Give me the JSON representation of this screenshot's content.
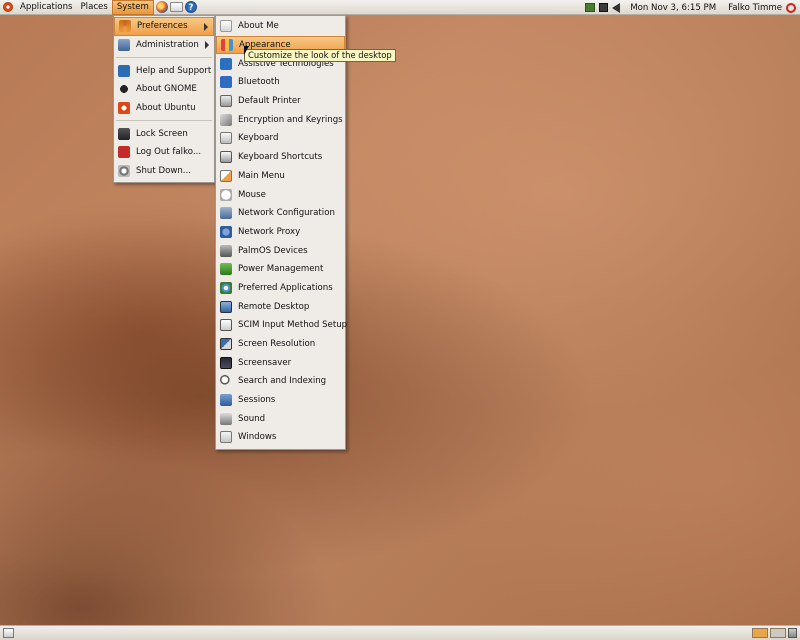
{
  "top_panel": {
    "menus": [
      "Applications",
      "Places",
      "System"
    ],
    "launchers": [
      "firefox-icon",
      "mail-icon",
      "help-icon"
    ],
    "help_glyph": "?",
    "clock": "Mon Nov  3,  6:15 PM",
    "user": "Falko Timme"
  },
  "system_menu": {
    "items": [
      {
        "label": "Preferences",
        "icon": "preferences-icon",
        "submenu": true
      },
      {
        "label": "Administration",
        "icon": "administration-icon",
        "submenu": true
      },
      {
        "label": "Help and Support",
        "icon": "help-icon"
      },
      {
        "label": "About GNOME",
        "icon": "gnome-foot-icon"
      },
      {
        "label": "About Ubuntu",
        "icon": "ubuntu-icon"
      },
      {
        "label": "Lock Screen",
        "icon": "lock-icon"
      },
      {
        "label": "Log Out falko...",
        "icon": "logout-icon"
      },
      {
        "label": "Shut Down...",
        "icon": "shutdown-icon"
      }
    ]
  },
  "preferences_menu": {
    "items": [
      "About Me",
      "Appearance",
      "Assistive Technologies",
      "Bluetooth",
      "Default Printer",
      "Encryption and Keyrings",
      "Keyboard",
      "Keyboard Shortcuts",
      "Main Menu",
      "Mouse",
      "Network Configuration",
      "Network Proxy",
      "PalmOS Devices",
      "Power Management",
      "Preferred Applications",
      "Remote Desktop",
      "SCIM Input Method Setup",
      "Screen Resolution",
      "Screensaver",
      "Search and Indexing",
      "Sessions",
      "Sound",
      "Windows"
    ],
    "highlighted": "Appearance"
  },
  "tooltip": "Customize the look of the desktop",
  "colors": {
    "highlight": "#eea04a",
    "menu_bg": "#efebe7",
    "desktop": "#b77a55"
  }
}
